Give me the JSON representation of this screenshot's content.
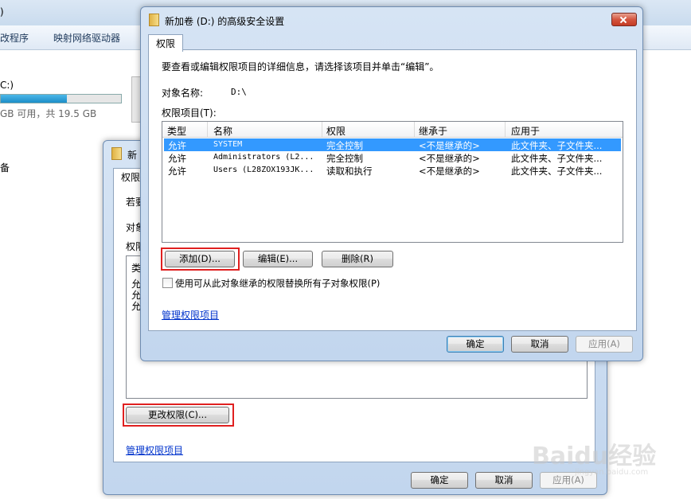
{
  "explorer": {
    "title_fragment": ")",
    "toolbar": [
      "改程序",
      "映射网络驱动器"
    ],
    "drive_label": "C:)",
    "drive_used_fraction": 0.55,
    "drive_free": "GB 可用，共 19.5 GB",
    "side_text": "备"
  },
  "back_dialog": {
    "title_fragment": "新",
    "tab": "权限",
    "line1": "若要",
    "line2": "对象",
    "line3": "权限",
    "list_rows": [
      "类",
      "允",
      "允",
      "允"
    ],
    "change_button": "更改权限(C)...",
    "manage_link": "管理权限项目",
    "ok": "确定",
    "cancel": "取消",
    "apply": "应用(A)"
  },
  "front_dialog": {
    "title": "新加卷 (D:) 的高级安全设置",
    "tab": "权限",
    "instruction": "要查看或编辑权限项目的详细信息，请选择该项目并单击“编辑”。",
    "object_name_label": "对象名称:",
    "object_name_value": "D:\\",
    "entries_label": "权限项目(T):",
    "columns": [
      "类型",
      "名称",
      "权限",
      "继承于",
      "应用于"
    ],
    "rows": [
      {
        "type": "允许",
        "name": "SYSTEM",
        "perm": "完全控制",
        "inherit": "<不是继承的>",
        "apply": "此文件夹、子文件夹..."
      },
      {
        "type": "允许",
        "name": "Administrators (L2...",
        "perm": "完全控制",
        "inherit": "<不是继承的>",
        "apply": "此文件夹、子文件夹..."
      },
      {
        "type": "允许",
        "name": "Users (L28ZOX193JK...",
        "perm": "读取和执行",
        "inherit": "<不是继承的>",
        "apply": "此文件夹、子文件夹..."
      }
    ],
    "add_button": "添加(D)...",
    "edit_button": "编辑(E)...",
    "delete_button": "删除(R)",
    "replace_checkbox": "使用可从此对象继承的权限替换所有子对象权限(P)",
    "manage_link": "管理权限项目",
    "ok": "确定",
    "cancel": "取消",
    "apply": "应用(A)"
  },
  "watermark": {
    "text": "Baidu经验",
    "sub": "jingyan.baidu.com"
  }
}
